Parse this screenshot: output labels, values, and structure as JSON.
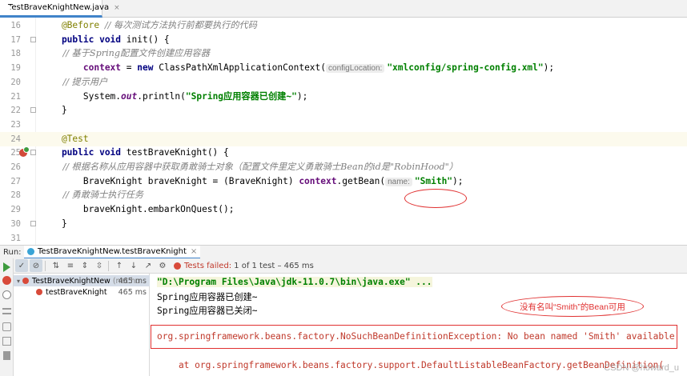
{
  "editor_tab": {
    "filename": "TestBraveKnightNew.java",
    "close": "×"
  },
  "code_lines": [
    {
      "num": "16",
      "segments": [
        [
          "ann",
          "    @Before "
        ],
        [
          "cm",
          "// 每次测试方法执行前都要执行的代码"
        ]
      ]
    },
    {
      "num": "17",
      "segments": [
        [
          "kw",
          "    public void "
        ],
        [
          "txt",
          "init() {"
        ]
      ]
    },
    {
      "num": "18",
      "segments": [
        [
          "cm",
          "        // 基于Spring配置文件创建应用容器"
        ]
      ]
    },
    {
      "num": "19",
      "segments": [
        [
          "fld",
          "        context"
        ],
        [
          "txt",
          " = "
        ],
        [
          "kw",
          "new "
        ],
        [
          "txt",
          "ClassPathXmlApplicationContext("
        ],
        [
          "hint",
          "configLocation:"
        ],
        [
          "str",
          "\"xmlconfig/spring-config.xml\""
        ],
        [
          "txt",
          ");"
        ]
      ]
    },
    {
      "num": "20",
      "segments": [
        [
          "cm",
          "        // 提示用户"
        ]
      ]
    },
    {
      "num": "21",
      "segments": [
        [
          "txt",
          "        System."
        ],
        [
          "st",
          "out"
        ],
        [
          "txt",
          ".println("
        ],
        [
          "str",
          "\"Spring应用容器已创建~\""
        ],
        [
          "txt",
          ");"
        ]
      ]
    },
    {
      "num": "22",
      "segments": [
        [
          "txt",
          "    }"
        ]
      ]
    },
    {
      "num": "23",
      "segments": []
    },
    {
      "num": "24",
      "segments": [
        [
          "ann",
          "    @Test"
        ]
      ]
    },
    {
      "num": "25",
      "segments": [
        [
          "kw",
          "    public void "
        ],
        [
          "txt",
          "testBraveKnight() {"
        ]
      ]
    },
    {
      "num": "26",
      "segments": [
        [
          "cm",
          "        // 根据名称从应用容器中获取勇敢骑士对象（配置文件里定义勇敢骑士Bean的id是\"RobinHood\"）"
        ]
      ]
    },
    {
      "num": "27",
      "segments": [
        [
          "txt",
          "        BraveKnight braveKnight = (BraveKnight) "
        ],
        [
          "fld",
          "context"
        ],
        [
          "txt",
          ".getBean("
        ],
        [
          "hint",
          "name:"
        ],
        [
          "str",
          "\"Smith\""
        ],
        [
          "txt",
          ");"
        ]
      ]
    },
    {
      "num": "28",
      "segments": [
        [
          "cm",
          "        // 勇敢骑士执行任务"
        ]
      ]
    },
    {
      "num": "29",
      "segments": [
        [
          "txt",
          "        braveKnight.embarkOnQuest();"
        ]
      ]
    },
    {
      "num": "30",
      "segments": [
        [
          "txt",
          "    }"
        ]
      ]
    },
    {
      "num": "31",
      "segments": []
    }
  ],
  "run_panel": {
    "label": "Run:",
    "tab": "TestBraveKnightNew.testBraveKnight",
    "close": "×",
    "status_failed": "Tests failed:",
    "status_rest": "1 of 1 test – 465 ms"
  },
  "tree": [
    {
      "name": "TestBraveKnightNew",
      "pkg": "(net.hu",
      "time": "465 ms"
    },
    {
      "name": "testBraveKnight",
      "pkg": "",
      "time": "465 ms"
    }
  ],
  "console": {
    "java_cmd": "\"D:\\Program Files\\Java\\jdk-11.0.7\\bin\\java.exe\" ...",
    "created": "Spring应用容器已创建~",
    "closed": "Spring应用容器已关闭~",
    "exception": "org.springframework.beans.factory.NoSuchBeanDefinitionException: No bean named 'Smith' available",
    "stack": "    at org.springframework.beans.factory.support.DefaultListableBeanFactory.getBeanDefinition("
  },
  "annotation_note": "没有名叫“Smith”的Bean可用",
  "watermark": "CSDN @howard_u"
}
